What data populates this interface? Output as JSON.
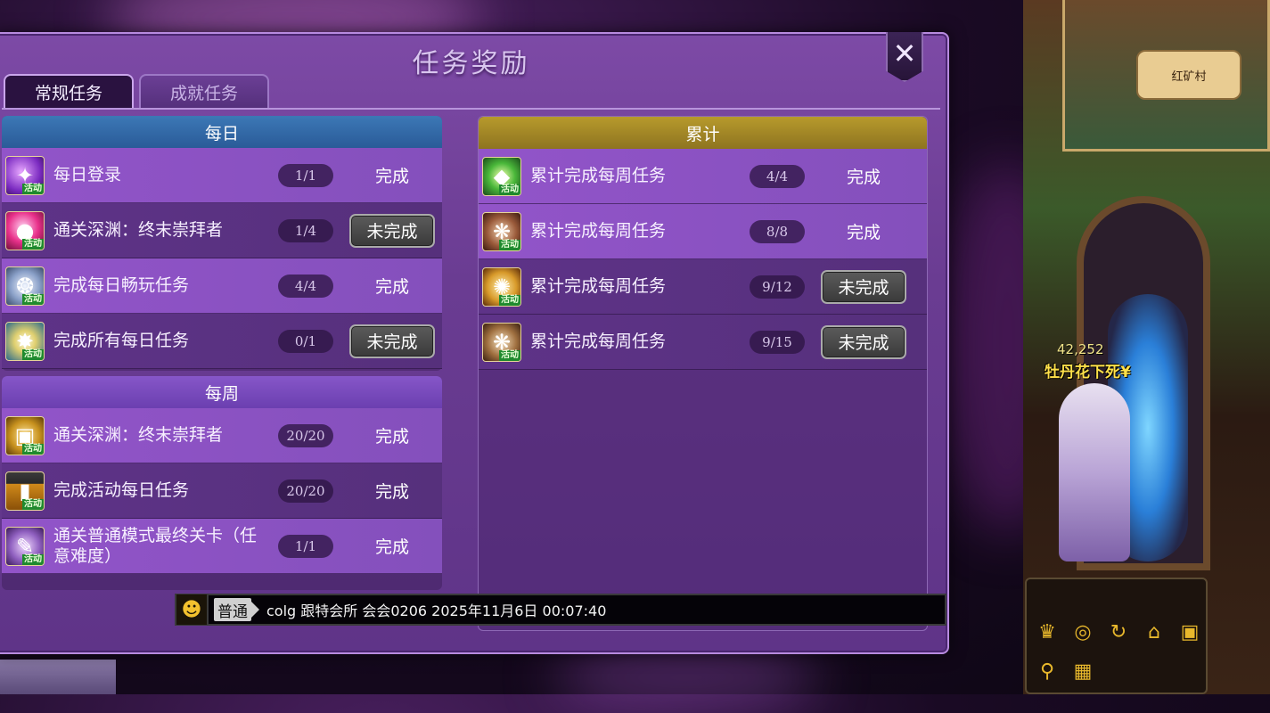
{
  "dialog": {
    "title": "任务奖励",
    "close_label": "✕"
  },
  "tabs": [
    {
      "label": "常规任务",
      "active": true
    },
    {
      "label": "成就任务",
      "active": false
    }
  ],
  "daily": {
    "header": "每日",
    "rows": [
      {
        "label": "每日登录",
        "progress": "1/1",
        "status": "完成",
        "icon": "magic-orb-icon"
      },
      {
        "label": "通关深渊：终末崇拜者",
        "progress": "1/4",
        "status": "未完成",
        "icon": "pink-orb-icon"
      },
      {
        "label": "完成每日畅玩任务",
        "progress": "4/4",
        "status": "完成",
        "icon": "silver-emblem-icon"
      },
      {
        "label": "完成所有每日任务",
        "progress": "0/1",
        "status": "未完成",
        "icon": "sparkle-icon"
      }
    ]
  },
  "weekly": {
    "header": "每周",
    "rows": [
      {
        "label": "通关深渊：终末崇拜者",
        "progress": "20/20",
        "status": "完成",
        "icon": "gold-chest-icon"
      },
      {
        "label": "完成活动每日任务",
        "progress": "20/20",
        "status": "完成",
        "icon": "potion-bottle-icon"
      },
      {
        "label": "通关普通模式最终关卡（任意难度）",
        "progress": "1/1",
        "status": "完成",
        "icon": "purple-scroll-icon"
      }
    ]
  },
  "cumulative": {
    "header": "累计",
    "rows": [
      {
        "label": "累计完成每周任务",
        "progress": "4/4",
        "status": "完成",
        "icon": "green-gem-icon"
      },
      {
        "label": "累计完成每周任务",
        "progress": "8/8",
        "status": "完成",
        "icon": "bronze-emblem-icon"
      },
      {
        "label": "累计完成每周任务",
        "progress": "9/12",
        "status": "未完成",
        "icon": "gold-box-icon"
      },
      {
        "label": "累计完成每周任务",
        "progress": "9/15",
        "status": "未完成",
        "icon": "bronze-emblem-icon"
      }
    ]
  },
  "event_tag": "活动",
  "chat": {
    "channel": "普通",
    "message": "colg 跟特会所 会会0206 2025年11月6日 00:07:40"
  },
  "game": {
    "minimap_location": "红矿村",
    "hero_score": "42,252",
    "hero_name": "牡丹花下死¥"
  },
  "colors": {
    "daily_header": "#2a5b98",
    "weekly_header": "#6b3fb0",
    "cumulative_header": "#8e7420",
    "done_text": "#ffffff",
    "todo_button": "#3a3a3a"
  }
}
